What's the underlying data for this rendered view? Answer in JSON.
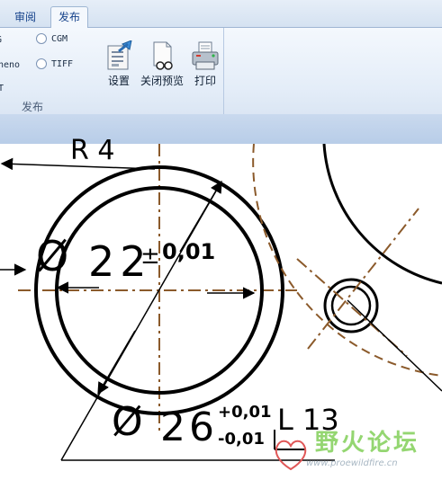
{
  "ribbon": {
    "tabs": [
      {
        "label": "审阅",
        "active": false
      },
      {
        "label": "发布",
        "active": true
      }
    ],
    "formats": [
      {
        "label": "G",
        "checked": false
      },
      {
        "label": "CGM",
        "checked": false
      },
      {
        "label": "neno",
        "checked": false
      },
      {
        "label": "TIFF",
        "checked": false
      },
      {
        "label": "T",
        "checked": false
      }
    ],
    "buttons": {
      "settings": "设置",
      "close_preview": "关闭预览",
      "print": "打印"
    },
    "group_label": "发布"
  },
  "drawing": {
    "radius_label": "R 4",
    "hole_dim": {
      "symbol": "Ø",
      "value": "22",
      "tol_sym": "±",
      "tol": "0,01"
    },
    "outer_dim": {
      "symbol": "Ø",
      "value": "26",
      "tol_plus": "+0,01",
      "tol_minus": "-0,01"
    },
    "length_label": "L  13",
    "colors": {
      "centerline": "#8b5a2b",
      "ink": "#000000"
    }
  },
  "watermark": {
    "text": "野火论坛",
    "url": "www.proewildfire.cn"
  }
}
